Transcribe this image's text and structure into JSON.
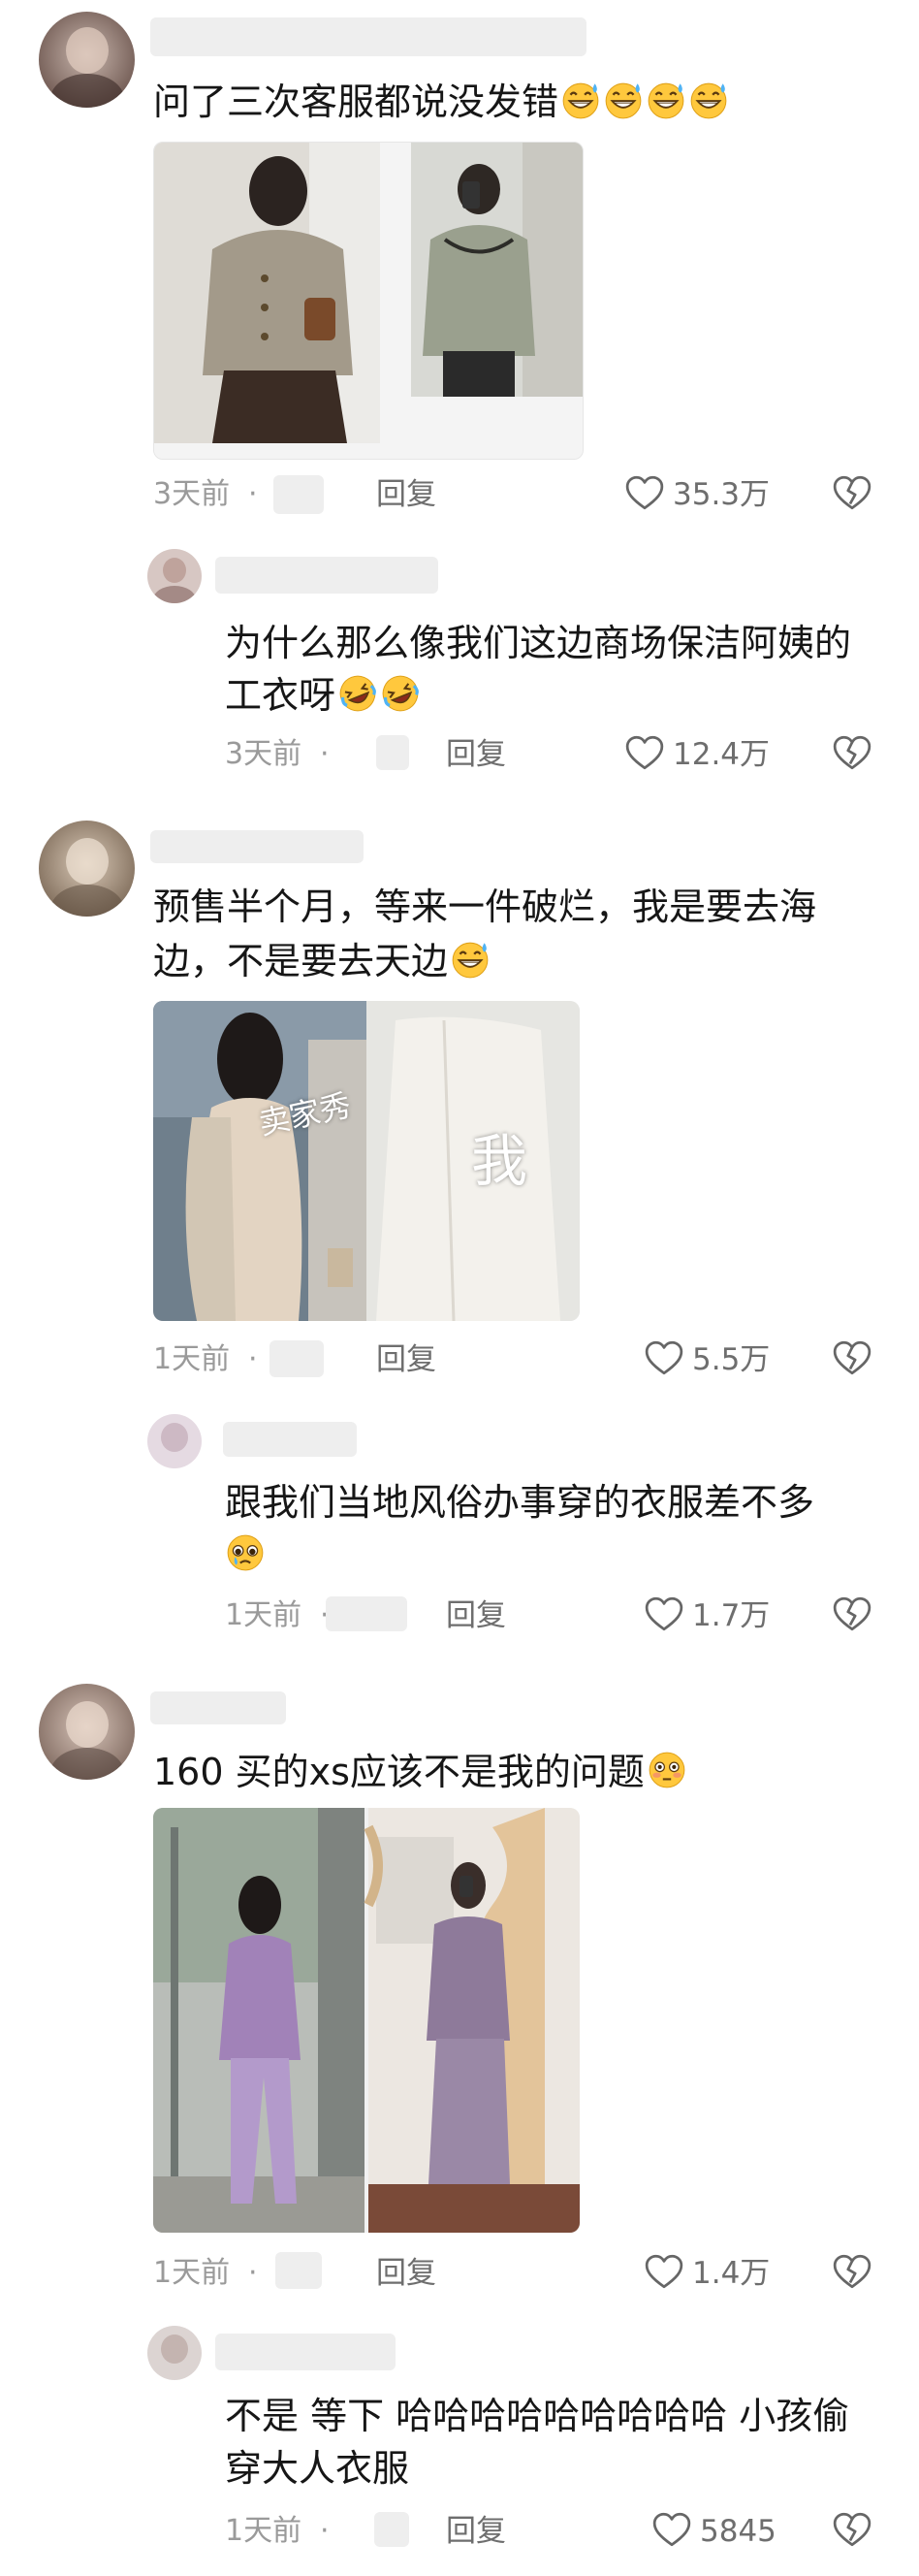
{
  "comments": [
    {
      "text": "问了三次客服都说没发错",
      "emojis": [
        "grinning-sweat-emoji",
        "grinning-sweat-emoji",
        "grinning-sweat-emoji",
        "grinning-sweat-emoji"
      ],
      "time": "3天前",
      "reply_label": "回复",
      "likes": "35.3万",
      "reply": {
        "text_line1": "为什么那么像我们这边商场保洁阿姨的",
        "text_line2": "工衣呀",
        "emojis": [
          "rolling-laugh-emoji",
          "rolling-laugh-emoji"
        ],
        "time": "3天前",
        "reply_label": "回复",
        "likes": "12.4万"
      }
    },
    {
      "text_line1": "预售半个月，等来一件破烂，我是要去海",
      "text_line2": "边，不是要去天边",
      "emojis": [
        "grinning-sweat-emoji"
      ],
      "image_labels": [
        "卖家秀",
        "我"
      ],
      "time": "1天前",
      "reply_label": "回复",
      "likes": "5.5万",
      "reply": {
        "text_line1": "跟我们当地风俗办事穿的衣服差不多",
        "emojis": [
          "pleading-emoji"
        ],
        "time": "1天前",
        "reply_label": "回复",
        "likes": "1.7万"
      }
    },
    {
      "text": "160 买的xs应该不是我的问题",
      "emojis": [
        "flushed-emoji"
      ],
      "time": "1天前",
      "reply_label": "回复",
      "likes": "1.4万",
      "reply": {
        "text_line1": "不是 等下 哈哈哈哈哈哈哈哈哈 小孩偷",
        "text_line2": "穿大人衣服",
        "time": "1天前",
        "reply_label": "回复",
        "likes": "5845"
      }
    }
  ],
  "colors": {
    "text": "#161616",
    "meta": "#9a9a9a",
    "action": "#6e6e6e",
    "emoji_face": "#FFC83D",
    "sweat": "#4FB3F5"
  }
}
